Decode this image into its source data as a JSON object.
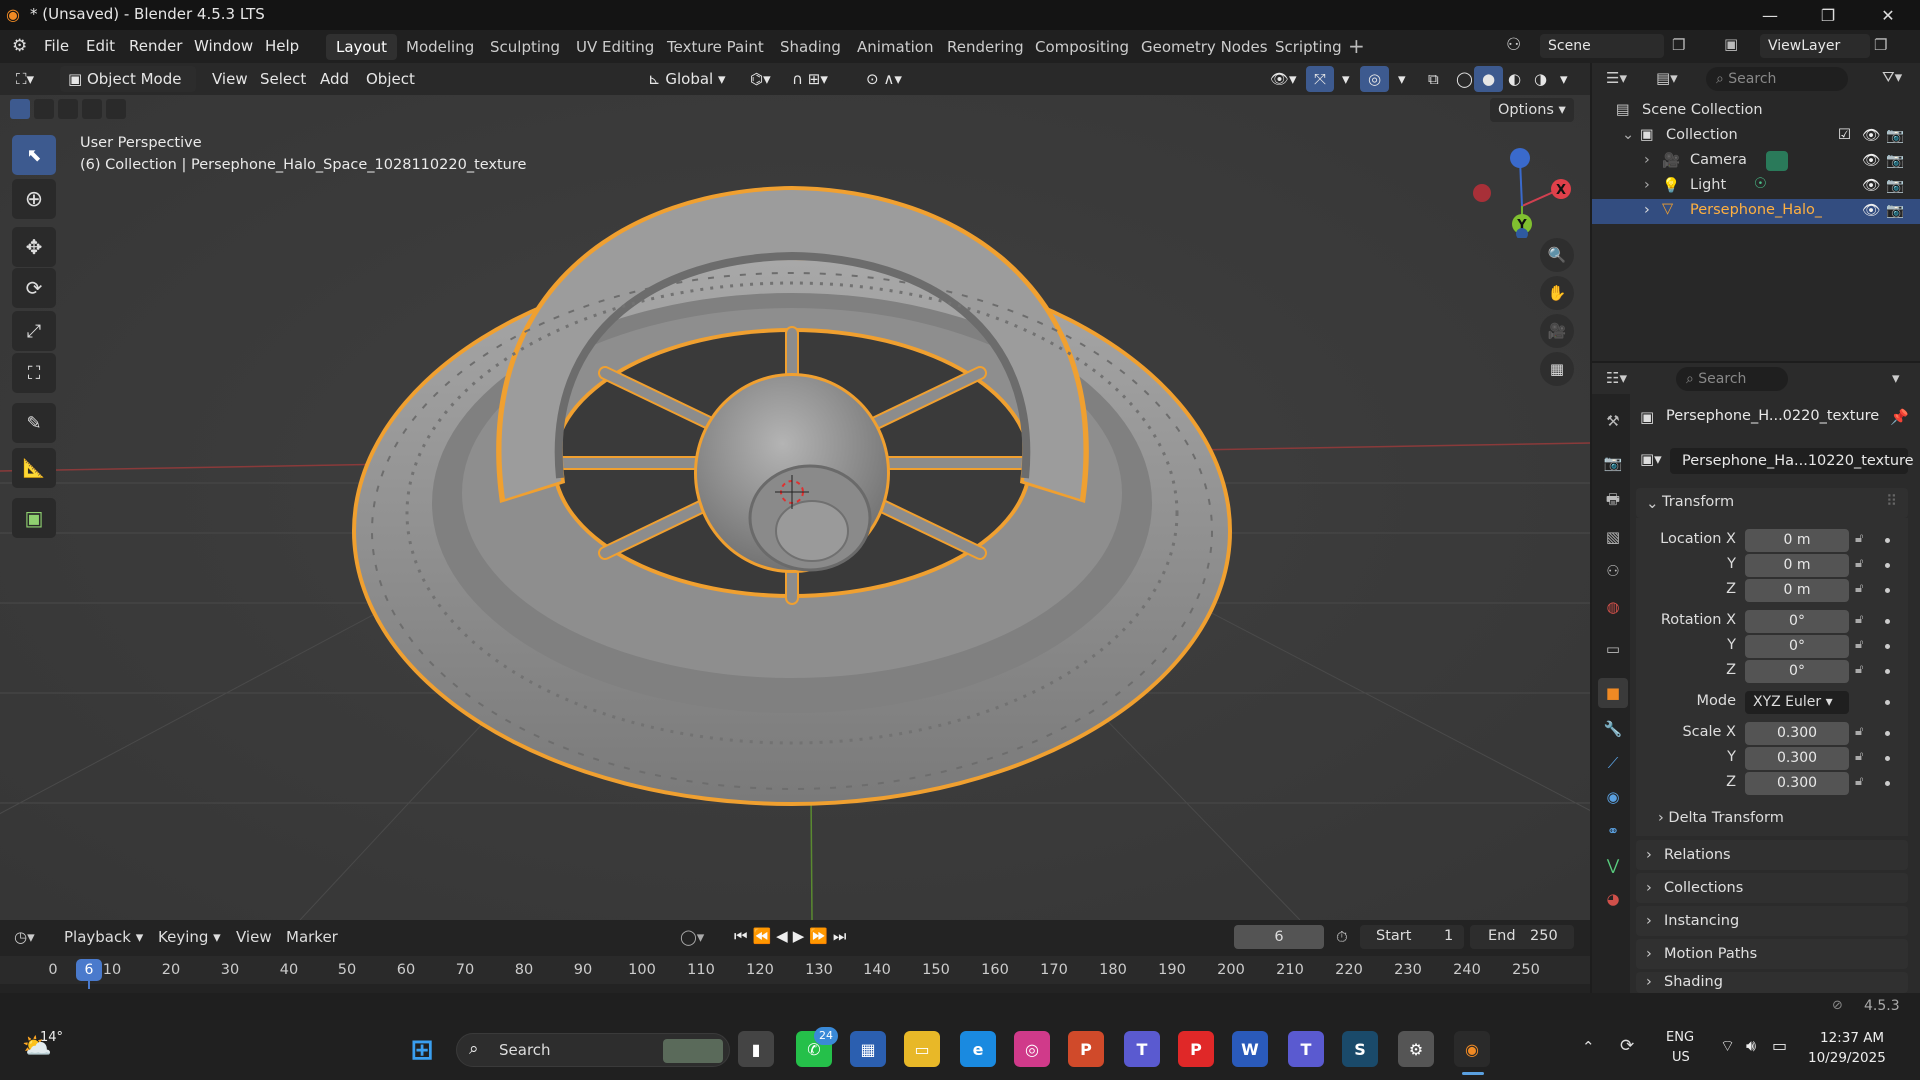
{
  "window": {
    "title": "* (Unsaved) - Blender 4.5.3 LTS"
  },
  "menubar": {
    "items": [
      "File",
      "Edit",
      "Render",
      "Window",
      "Help"
    ]
  },
  "workspaces": [
    "Layout",
    "Modeling",
    "Sculpting",
    "UV Editing",
    "Texture Paint",
    "Shading",
    "Animation",
    "Rendering",
    "Compositing",
    "Geometry Nodes",
    "Scripting"
  ],
  "active_workspace": "Layout",
  "scene": {
    "name": "Scene",
    "view_layer": "ViewLayer"
  },
  "viewport_header": {
    "mode": "Object Mode",
    "menus": [
      "View",
      "Select",
      "Add",
      "Object"
    ],
    "orientation": "Global",
    "options_label": "Options"
  },
  "viewport": {
    "perspective_label": "User Perspective",
    "collection_label": "(6) Collection | Persephone_Halo_Space_1028110220_texture",
    "gizmo_axes": {
      "x": "X",
      "y": "Y"
    },
    "selection_color": "#f0a030"
  },
  "outliner": {
    "search_placeholder": "Search",
    "scene_collection": "Scene Collection",
    "collection": "Collection",
    "items": [
      {
        "name": "Camera",
        "type": "camera"
      },
      {
        "name": "Light",
        "type": "light"
      },
      {
        "name": "Persephone_Halo_Sp",
        "type": "mesh",
        "selected": true
      }
    ]
  },
  "properties": {
    "search_placeholder": "Search",
    "object_name_header": "Persephone_H...0220_texture",
    "object_name_field": "Persephone_Ha...10220_texture",
    "transform_label": "Transform",
    "location_label": "Location X",
    "rotation_label": "Rotation X",
    "scale_label": "Scale X",
    "mode_label": "Mode",
    "axis_y": "Y",
    "axis_z": "Z",
    "location": [
      "0 m",
      "0 m",
      "0 m"
    ],
    "rotation": [
      "0°",
      "0°",
      "0°"
    ],
    "rotation_mode": "XYZ Euler",
    "scale": [
      "0.300",
      "0.300",
      "0.300"
    ],
    "delta_transform": "Delta Transform",
    "sections": [
      "Relations",
      "Collections",
      "Instancing",
      "Motion Paths",
      "Shading"
    ]
  },
  "timeline": {
    "menus": [
      "Playback",
      "Keying",
      "View",
      "Marker"
    ],
    "current_frame": "6",
    "start_label": "Start",
    "start": "1",
    "end_label": "End",
    "end": "250",
    "ticks": [
      "0",
      "10",
      "20",
      "30",
      "40",
      "50",
      "60",
      "70",
      "80",
      "90",
      "100",
      "110",
      "120",
      "130",
      "140",
      "150",
      "160",
      "170",
      "180",
      "190",
      "200",
      "210",
      "220",
      "230",
      "240",
      "250"
    ],
    "frame_marker": "6"
  },
  "statusbar": {
    "version": "4.5.3"
  },
  "taskbar": {
    "weather": "14°",
    "search_placeholder": "Search",
    "whatsapp_badge": "24",
    "lang_line1": "ENG",
    "lang_line2": "US",
    "time": "12:37 AM",
    "date": "10/29/2025"
  }
}
